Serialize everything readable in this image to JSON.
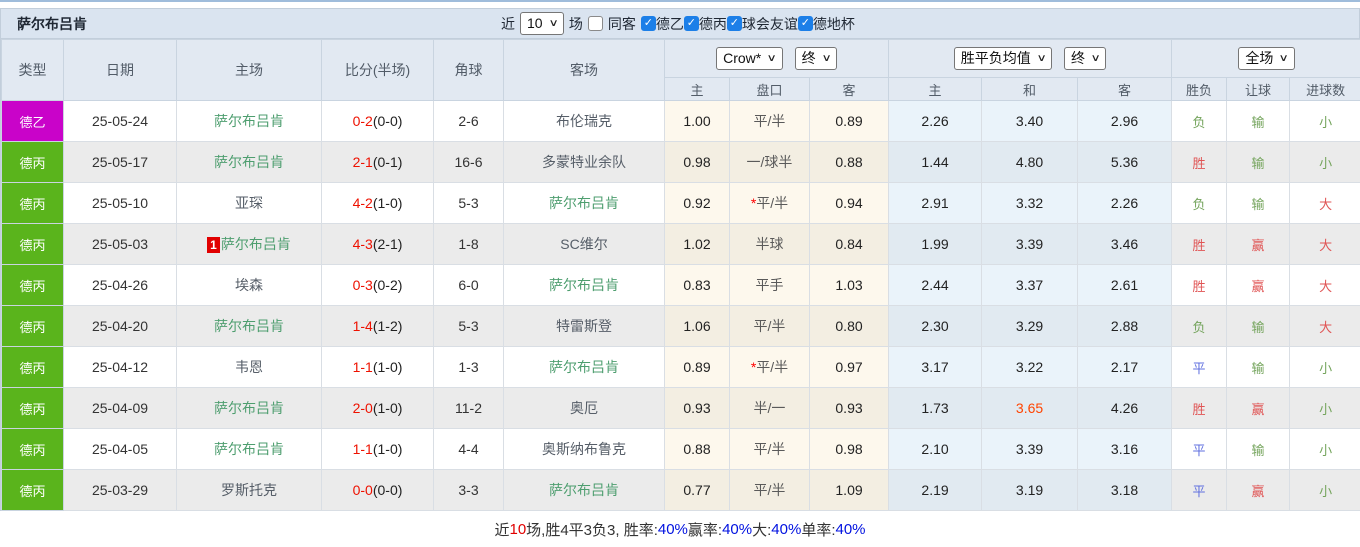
{
  "header": {
    "team_title": "萨尔布吕肯",
    "filter": {
      "recent_label": "近",
      "recent_value": "10",
      "matches_label": "场",
      "same_venue_label": "同客",
      "same_venue_checked": false,
      "leagues": [
        {
          "label": "德乙",
          "checked": true
        },
        {
          "label": "德丙",
          "checked": true
        },
        {
          "label": "球会友谊",
          "checked": true
        },
        {
          "label": "德地杯",
          "checked": true
        }
      ]
    }
  },
  "table": {
    "left_headers": [
      "类型",
      "日期",
      "主场",
      "比分(半场)",
      "角球",
      "客场"
    ],
    "selects": {
      "bookmaker": "Crow*",
      "bookmaker_period": "终",
      "average": "胜平负均值",
      "average_period": "终",
      "scope": "全场"
    },
    "sub_headers": [
      "主",
      "盘口",
      "客",
      "主",
      "和",
      "客",
      "胜负",
      "让球",
      "进球数"
    ],
    "type_colors": {
      "德乙": "#C903C9",
      "德丙": "#5AB41C"
    },
    "rows": [
      {
        "type": "德乙",
        "date": "25-05-24",
        "home": {
          "name": "萨尔布吕肯",
          "self": true
        },
        "score": "0-2",
        "half": "(0-0)",
        "corner": "2-6",
        "away": {
          "name": "布伦瑞克",
          "self": false
        },
        "odds_home": "1.00",
        "handicap": "平/半",
        "handicap_star": false,
        "odds_away": "0.89",
        "avg_home": "2.26",
        "avg_draw": "3.40",
        "avg_away": "2.96",
        "wdl": {
          "text": "负",
          "color": "green"
        },
        "let": {
          "text": "输",
          "color": "green"
        },
        "goals": {
          "text": "小",
          "color": "green"
        }
      },
      {
        "type": "德丙",
        "date": "25-05-17",
        "home": {
          "name": "萨尔布吕肯",
          "self": true
        },
        "score": "2-1",
        "half": "(0-1)",
        "corner": "16-6",
        "away": {
          "name": "多蒙特业余队",
          "self": false
        },
        "odds_home": "0.98",
        "handicap": "一/球半",
        "handicap_star": false,
        "odds_away": "0.88",
        "avg_home": "1.44",
        "avg_draw": "4.80",
        "avg_away": "5.36",
        "wdl": {
          "text": "胜",
          "color": "red"
        },
        "let": {
          "text": "输",
          "color": "green"
        },
        "goals": {
          "text": "小",
          "color": "green"
        }
      },
      {
        "type": "德丙",
        "date": "25-05-10",
        "home": {
          "name": "亚琛",
          "self": false
        },
        "score": "4-2",
        "half": "(1-0)",
        "corner": "5-3",
        "away": {
          "name": "萨尔布吕肯",
          "self": true
        },
        "odds_home": "0.92",
        "handicap": "平/半",
        "handicap_star": true,
        "odds_away": "0.94",
        "avg_home": "2.91",
        "avg_draw": "3.32",
        "avg_away": "2.26",
        "wdl": {
          "text": "负",
          "color": "green"
        },
        "let": {
          "text": "输",
          "color": "green"
        },
        "goals": {
          "text": "大",
          "color": "red"
        }
      },
      {
        "type": "德丙",
        "date": "25-05-03",
        "home": {
          "name": "萨尔布吕肯",
          "self": true,
          "badge": "1"
        },
        "score": "4-3",
        "half": "(2-1)",
        "corner": "1-8",
        "away": {
          "name": "SC维尔",
          "self": false
        },
        "odds_home": "1.02",
        "handicap": "半球",
        "handicap_star": false,
        "odds_away": "0.84",
        "avg_home": "1.99",
        "avg_draw": "3.39",
        "avg_away": "3.46",
        "wdl": {
          "text": "胜",
          "color": "red"
        },
        "let": {
          "text": "赢",
          "color": "red"
        },
        "goals": {
          "text": "大",
          "color": "red"
        }
      },
      {
        "type": "德丙",
        "date": "25-04-26",
        "home": {
          "name": "埃森",
          "self": false
        },
        "score": "0-3",
        "half": "(0-2)",
        "corner": "6-0",
        "away": {
          "name": "萨尔布吕肯",
          "self": true
        },
        "odds_home": "0.83",
        "handicap": "平手",
        "handicap_star": false,
        "odds_away": "1.03",
        "avg_home": "2.44",
        "avg_draw": "3.37",
        "avg_away": "2.61",
        "wdl": {
          "text": "胜",
          "color": "red"
        },
        "let": {
          "text": "赢",
          "color": "red"
        },
        "goals": {
          "text": "大",
          "color": "red"
        }
      },
      {
        "type": "德丙",
        "date": "25-04-20",
        "home": {
          "name": "萨尔布吕肯",
          "self": true
        },
        "score": "1-4",
        "half": "(1-2)",
        "corner": "5-3",
        "away": {
          "name": "特雷斯登",
          "self": false
        },
        "odds_home": "1.06",
        "handicap": "平/半",
        "handicap_star": false,
        "odds_away": "0.80",
        "avg_home": "2.30",
        "avg_draw": "3.29",
        "avg_away": "2.88",
        "wdl": {
          "text": "负",
          "color": "green"
        },
        "let": {
          "text": "输",
          "color": "green"
        },
        "goals": {
          "text": "大",
          "color": "red"
        }
      },
      {
        "type": "德丙",
        "date": "25-04-12",
        "home": {
          "name": "韦恩",
          "self": false
        },
        "score": "1-1",
        "half": "(1-0)",
        "corner": "1-3",
        "away": {
          "name": "萨尔布吕肯",
          "self": true
        },
        "odds_home": "0.89",
        "handicap": "平/半",
        "handicap_star": true,
        "odds_away": "0.97",
        "avg_home": "3.17",
        "avg_draw": "3.22",
        "avg_away": "2.17",
        "wdl": {
          "text": "平",
          "color": "blue"
        },
        "let": {
          "text": "输",
          "color": "green"
        },
        "goals": {
          "text": "小",
          "color": "green"
        }
      },
      {
        "type": "德丙",
        "date": "25-04-09",
        "home": {
          "name": "萨尔布吕肯",
          "self": true
        },
        "score": "2-0",
        "half": "(1-0)",
        "corner": "11-2",
        "away": {
          "name": "奥厄",
          "self": false
        },
        "odds_home": "0.93",
        "handicap": "半/一",
        "handicap_star": false,
        "odds_away": "0.93",
        "avg_home": "1.73",
        "avg_draw": "3.65",
        "avg_draw_red": true,
        "avg_away": "4.26",
        "wdl": {
          "text": "胜",
          "color": "red"
        },
        "let": {
          "text": "赢",
          "color": "red"
        },
        "goals": {
          "text": "小",
          "color": "green"
        }
      },
      {
        "type": "德丙",
        "date": "25-04-05",
        "home": {
          "name": "萨尔布吕肯",
          "self": true
        },
        "score": "1-1",
        "half": "(1-0)",
        "corner": "4-4",
        "away": {
          "name": "奥斯纳布鲁克",
          "self": false
        },
        "odds_home": "0.88",
        "handicap": "平/半",
        "handicap_star": false,
        "odds_away": "0.98",
        "avg_home": "2.10",
        "avg_draw": "3.39",
        "avg_away": "3.16",
        "wdl": {
          "text": "平",
          "color": "blue"
        },
        "let": {
          "text": "输",
          "color": "green"
        },
        "goals": {
          "text": "小",
          "color": "green"
        }
      },
      {
        "type": "德丙",
        "date": "25-03-29",
        "home": {
          "name": "罗斯托克",
          "self": false
        },
        "score": "0-0",
        "half": "(0-0)",
        "corner": "3-3",
        "away": {
          "name": "萨尔布吕肯",
          "self": true
        },
        "odds_home": "0.77",
        "handicap": "平/半",
        "handicap_star": false,
        "odds_away": "1.09",
        "avg_home": "2.19",
        "avg_draw": "3.19",
        "avg_away": "3.18",
        "wdl": {
          "text": "平",
          "color": "blue"
        },
        "let": {
          "text": "赢",
          "color": "red"
        },
        "goals": {
          "text": "小",
          "color": "green"
        }
      }
    ]
  },
  "footer": {
    "segments": [
      {
        "text": "近",
        "color": "default"
      },
      {
        "text": "10",
        "color": "red"
      },
      {
        "text": "场,胜4平3负3, 胜率:",
        "color": "default"
      },
      {
        "text": "40%",
        "color": "blue"
      },
      {
        "text": " 赢率:",
        "color": "default"
      },
      {
        "text": "40%",
        "color": "blue"
      },
      {
        "text": " 大:",
        "color": "default"
      },
      {
        "text": "40%",
        "color": "blue"
      },
      {
        "text": " 单率:",
        "color": "default"
      },
      {
        "text": "40%",
        "color": "blue"
      }
    ]
  }
}
